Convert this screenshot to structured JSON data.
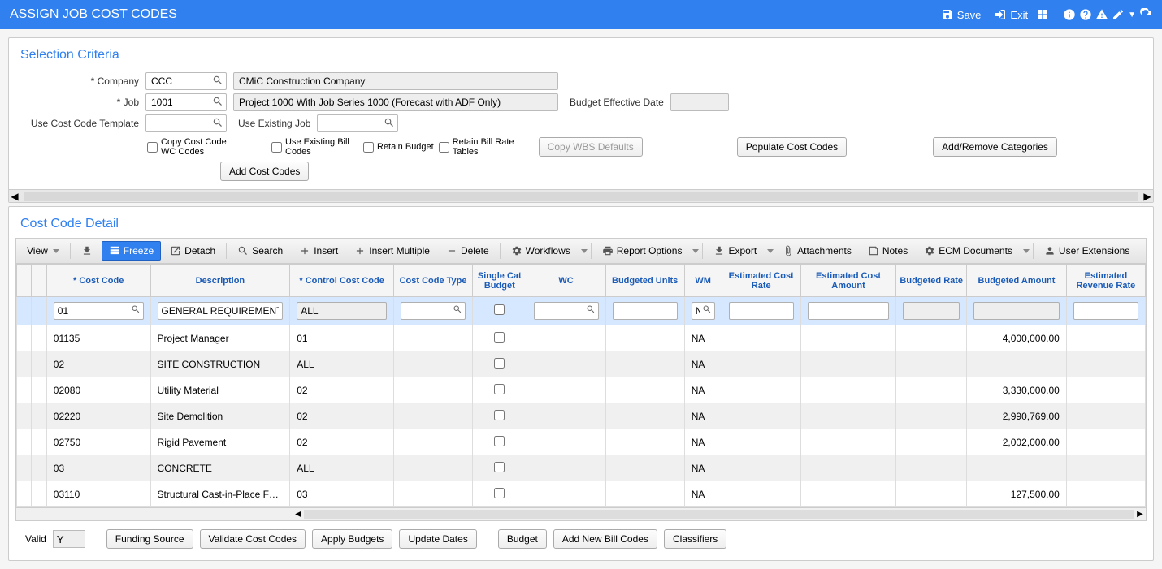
{
  "title": "ASSIGN JOB COST CODES",
  "titlebar": {
    "save": "Save",
    "exit": "Exit"
  },
  "selection": {
    "title": "Selection Criteria",
    "company_label": "Company",
    "company_value": "CCC",
    "company_name": "CMiC Construction Company",
    "job_label": "Job",
    "job_value": "1001",
    "job_name": "Project 1000 With Job Series 1000 (Forecast with ADF Only)",
    "budget_date_label": "Budget Effective Date",
    "budget_date_value": "",
    "template_label": "Use Cost Code Template",
    "template_value": "",
    "use_existing_label": "Use Existing Job",
    "use_existing_value": "",
    "chk_copy_wc": "Copy Cost Code WC Codes",
    "chk_use_bill": "Use Existing Bill Codes",
    "chk_retain_budget": "Retain Budget",
    "chk_retain_bill": "Retain Bill Rate Tables",
    "btn_copy_wbs": "Copy WBS Defaults",
    "btn_populate": "Populate Cost Codes",
    "btn_add_remove": "Add/Remove Categories",
    "btn_add_codes": "Add Cost Codes"
  },
  "detail": {
    "title": "Cost Code Detail",
    "toolbar": {
      "view": "View",
      "freeze": "Freeze",
      "detach": "Detach",
      "search": "Search",
      "insert": "Insert",
      "insert_multiple": "Insert Multiple",
      "delete": "Delete",
      "workflows": "Workflows",
      "report_options": "Report Options",
      "export": "Export",
      "attachments": "Attachments",
      "notes": "Notes",
      "ecm": "ECM Documents",
      "user_ext": "User Extensions"
    },
    "headers": {
      "cost_code": "* Cost Code",
      "description": "Description",
      "control": "* Control Cost Code",
      "cc_type": "Cost Code Type",
      "single_cat": "Single Cat Budget",
      "wc": "WC",
      "budgeted_units": "Budgeted Units",
      "wm": "WM",
      "est_rate": "Estimated Cost Rate",
      "est_amount": "Estimated Cost Amount",
      "budgeted_rate": "Budgeted Rate",
      "budgeted_amount": "Budgeted Amount",
      "est_rev_rate": "Estimated Revenue Rate"
    },
    "rows": [
      {
        "code": "01",
        "desc": "GENERAL REQUIREMENTS",
        "ctrl": "ALL",
        "wm": "NA",
        "amount": "",
        "sel": true
      },
      {
        "code": "01135",
        "desc": "Project Manager",
        "ctrl": "01",
        "wm": "NA",
        "amount": "4,000,000.00"
      },
      {
        "code": "02",
        "desc": "SITE CONSTRUCTION",
        "ctrl": "ALL",
        "wm": "NA",
        "amount": ""
      },
      {
        "code": "02080",
        "desc": "Utility Material",
        "ctrl": "02",
        "wm": "NA",
        "amount": "3,330,000.00"
      },
      {
        "code": "02220",
        "desc": "Site Demolition",
        "ctrl": "02",
        "wm": "NA",
        "amount": "2,990,769.00"
      },
      {
        "code": "02750",
        "desc": "Rigid Pavement",
        "ctrl": "02",
        "wm": "NA",
        "amount": "2,002,000.00"
      },
      {
        "code": "03",
        "desc": "CONCRETE",
        "ctrl": "ALL",
        "wm": "NA",
        "amount": ""
      },
      {
        "code": "03110",
        "desc": "Structural Cast-in-Place Forms",
        "ctrl": "03",
        "wm": "NA",
        "amount": "127,500.00"
      }
    ],
    "footer": {
      "valid_label": "Valid",
      "valid_value": "Y",
      "funding": "Funding Source",
      "validate": "Validate Cost Codes",
      "apply_budgets": "Apply Budgets",
      "update_dates": "Update Dates",
      "budget": "Budget",
      "add_bill": "Add New Bill Codes",
      "classifiers": "Classifiers"
    }
  }
}
